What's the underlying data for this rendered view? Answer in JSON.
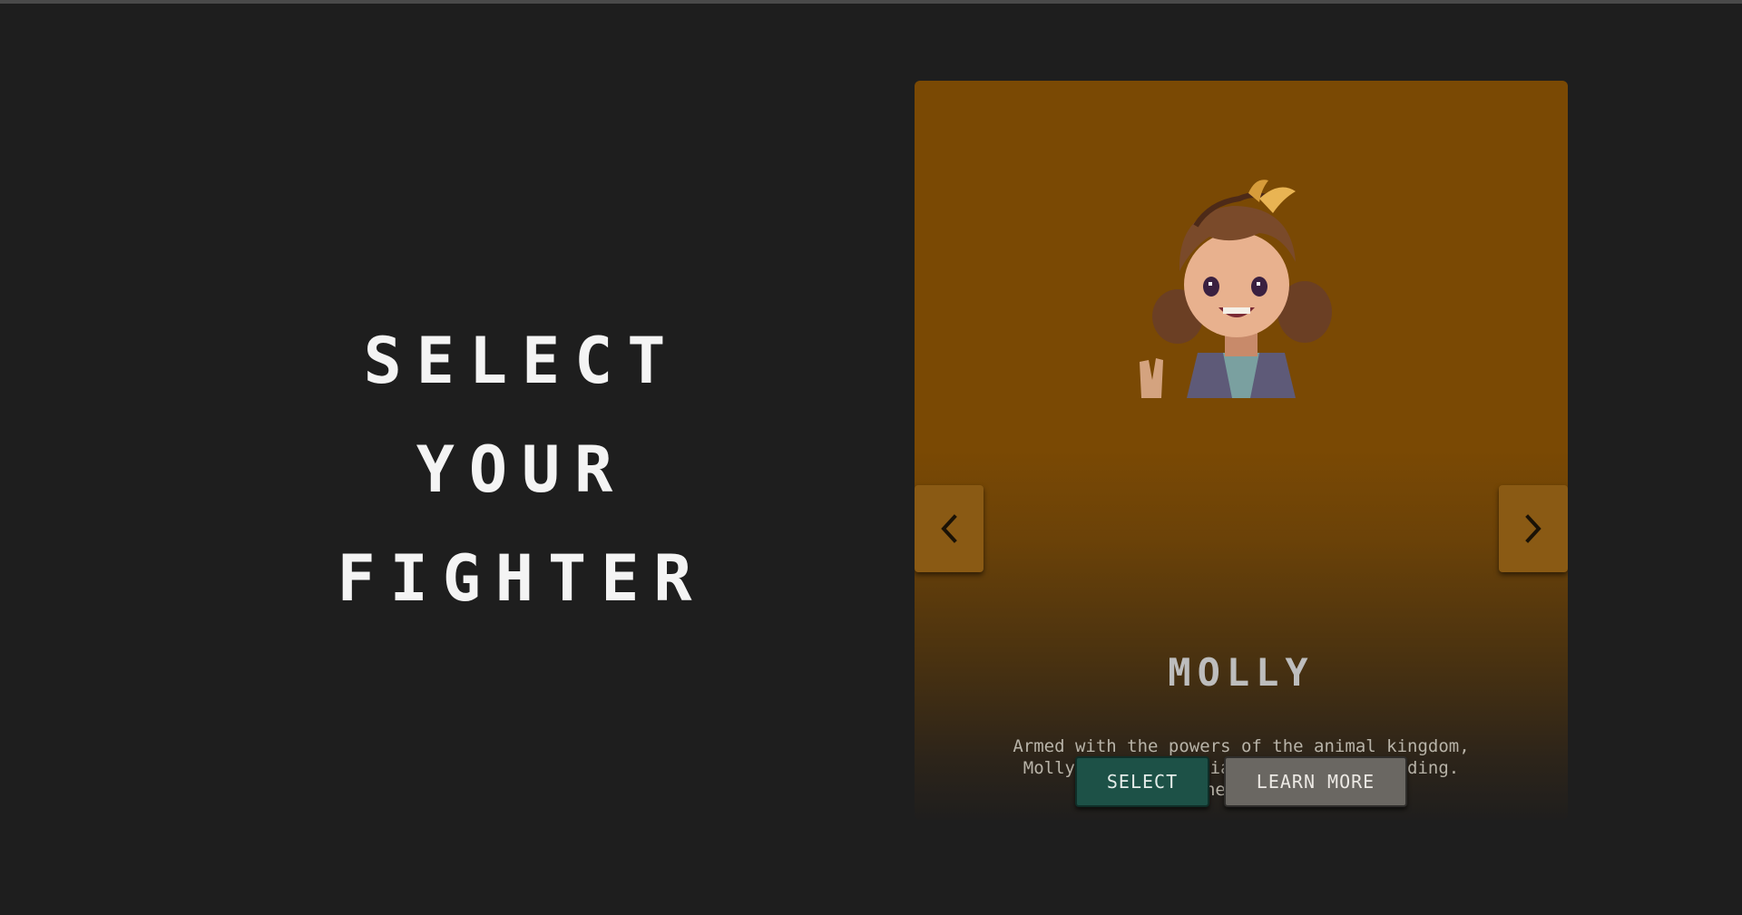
{
  "headline": {
    "line1": "SELECT",
    "line2": "YOUR",
    "line3": "FIGHTER"
  },
  "card": {
    "name": "MOLLY",
    "description": "Armed with the powers of the animal kingdom, Molly takes a special interest in reading. Oh, and she hates dark...",
    "select_label": "SELECT",
    "learn_more_label": "LEARN MORE",
    "prev_icon": "chevron-left-icon",
    "next_icon": "chevron-right-icon",
    "portrait_icon": "character-portrait"
  },
  "colors": {
    "background": "#1e1e1e",
    "card_top": "#7a4904",
    "select_button": "#1d5147",
    "learn_more_button": "#6a6762",
    "nav_button": "#8a5a14"
  }
}
